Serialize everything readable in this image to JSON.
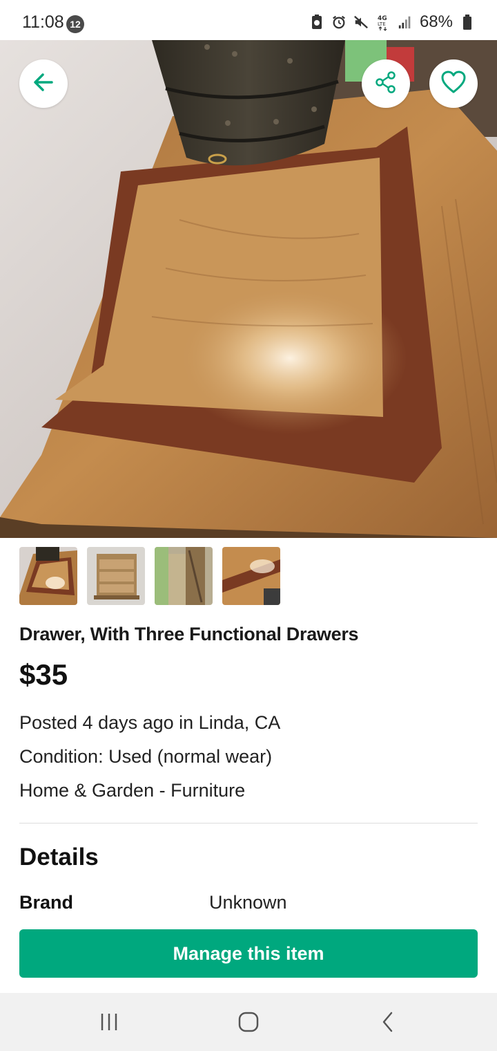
{
  "status_bar": {
    "time": "11:08",
    "notification_count": "12",
    "battery_percent": "68%",
    "icons": [
      "battery-saver-icon",
      "alarm-icon",
      "mute-icon",
      "4g-lte-icon",
      "signal-icon",
      "battery-icon"
    ]
  },
  "header_actions": {
    "back_icon": "arrow-left-icon",
    "share_icon": "share-icon",
    "favorite_icon": "heart-icon",
    "accent_color": "#00a87e"
  },
  "gallery": {
    "thumbnail_count": 4,
    "selected_index": 0
  },
  "listing": {
    "title": "Drawer, With Three  Functional Drawers",
    "price": "$35",
    "posted": "Posted 4 days ago in Linda, CA",
    "condition": "Condition: Used (normal wear)",
    "category": "Home & Garden - Furniture"
  },
  "details": {
    "heading": "Details",
    "rows": [
      {
        "label": "Brand",
        "value": "Unknown"
      }
    ]
  },
  "action": {
    "manage_label": "Manage this item",
    "button_color": "#00a87e"
  },
  "nav_bar": {
    "icons": [
      "recents-icon",
      "home-icon",
      "back-icon"
    ]
  }
}
